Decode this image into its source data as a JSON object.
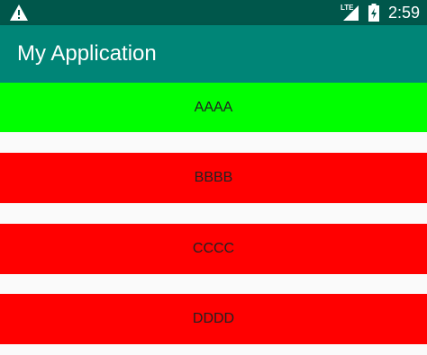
{
  "status_bar": {
    "time": "2:59",
    "network_label": "LTE",
    "icons": [
      "warning-icon",
      "lte-signal-icon",
      "battery-charging-icon"
    ],
    "background": "#00574b"
  },
  "app_bar": {
    "title": "My Application",
    "background": "#008577"
  },
  "list": {
    "items": [
      {
        "label": "AAAA",
        "color": "#00ff00"
      },
      {
        "label": "BBBB",
        "color": "#ff0000"
      },
      {
        "label": "CCCC",
        "color": "#ff0000"
      },
      {
        "label": "DDDD",
        "color": "#ff0000"
      }
    ]
  }
}
